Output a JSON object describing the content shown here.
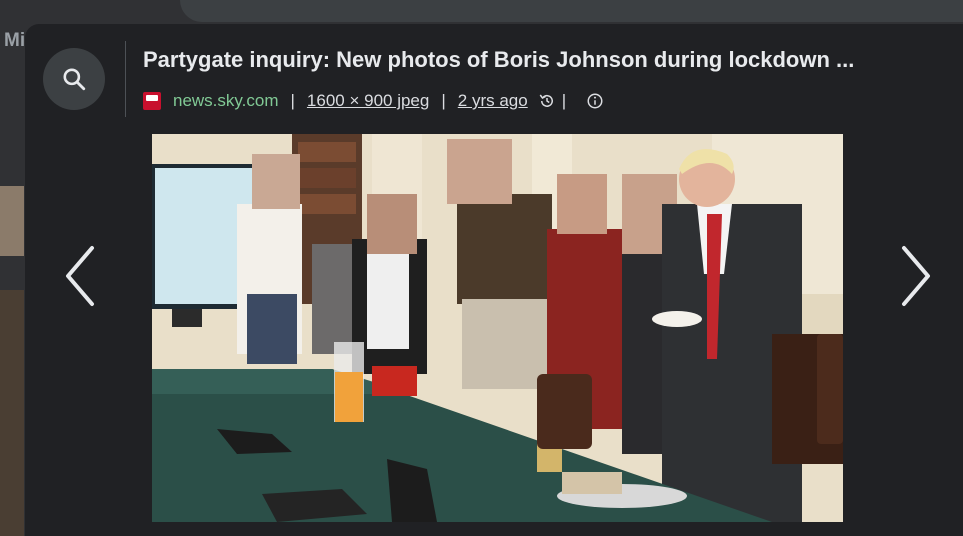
{
  "background": {
    "partial_text": "Mi"
  },
  "viewer": {
    "title": "Partygate inquiry: New photos of Boris Johnson during lockdown ...",
    "source_domain": "news.sky.com",
    "image_info": "1600 × 900 jpeg",
    "age": "2 yrs ago",
    "icons": {
      "search": "search-icon",
      "favicon": "sky-news-favicon",
      "history": "history-icon",
      "info": "info-icon",
      "prev": "chevron-left-icon",
      "next": "chevron-right-icon"
    },
    "colors": {
      "panel": "#202124",
      "domain": "#81c995",
      "title": "#e8eaed"
    }
  }
}
